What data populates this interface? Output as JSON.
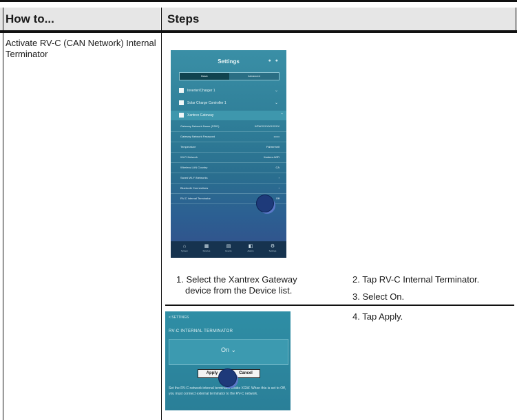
{
  "table": {
    "header": {
      "how_to": "How to...",
      "steps": "Steps"
    },
    "row": {
      "task": "Activate RV-C (CAN Network) Internal Terminator",
      "steps": [
        {
          "number": "1.",
          "text_line1": "Select the Xantrex Gateway",
          "text_line2": "device from the Device list."
        },
        {
          "text": "2. Tap RV-C Internal Terminator."
        },
        {
          "text": "3. Select On."
        },
        {
          "text": "4. Tap Apply."
        }
      ]
    }
  },
  "screenshot_settings": {
    "title": "Settings",
    "tabs": [
      "Basic",
      "Advanced"
    ],
    "devices": [
      "Inverter/Charger 1",
      "Solar Charge Controller 1",
      "Xantrex Gateway"
    ],
    "gateway_rows": [
      {
        "label": "Gateway Network Name (SSID)",
        "value": "XGWXXXXXXXXXX"
      },
      {
        "label": "Gateway Network Password",
        "value": "••••••"
      },
      {
        "label": "Temperature",
        "value": "Fahrenheit"
      },
      {
        "label": "Wi-Fi Network",
        "value": "Xantrex-WiFi"
      },
      {
        "label": "Wireless LAN Country",
        "value": "CA"
      },
      {
        "label": "Saved Wi-Fi Networks",
        "value": "›"
      },
      {
        "label": "Bluetooth Connections",
        "value": "›"
      },
      {
        "label": "RV-C Internal Terminator",
        "value": "Off"
      }
    ],
    "nav": [
      "System",
      "Devices",
      "Events",
      "Alarms",
      "Settings"
    ]
  },
  "screenshot_terminator": {
    "back_label": "< SETTINGS",
    "title": "RV-C INTERNAL TERMINATOR",
    "selected_value": "On",
    "apply_label": "Apply",
    "cancel_label": "Cancel",
    "note": "Set the RV-C network internal terminator inside XGW. When this is set to Off, you must connect external terminator to the RV-C network."
  },
  "colors": {
    "tap_indicator": "#1e3a7a",
    "app_background": "#2f7e98",
    "header_fill": "#e6e6e6"
  }
}
